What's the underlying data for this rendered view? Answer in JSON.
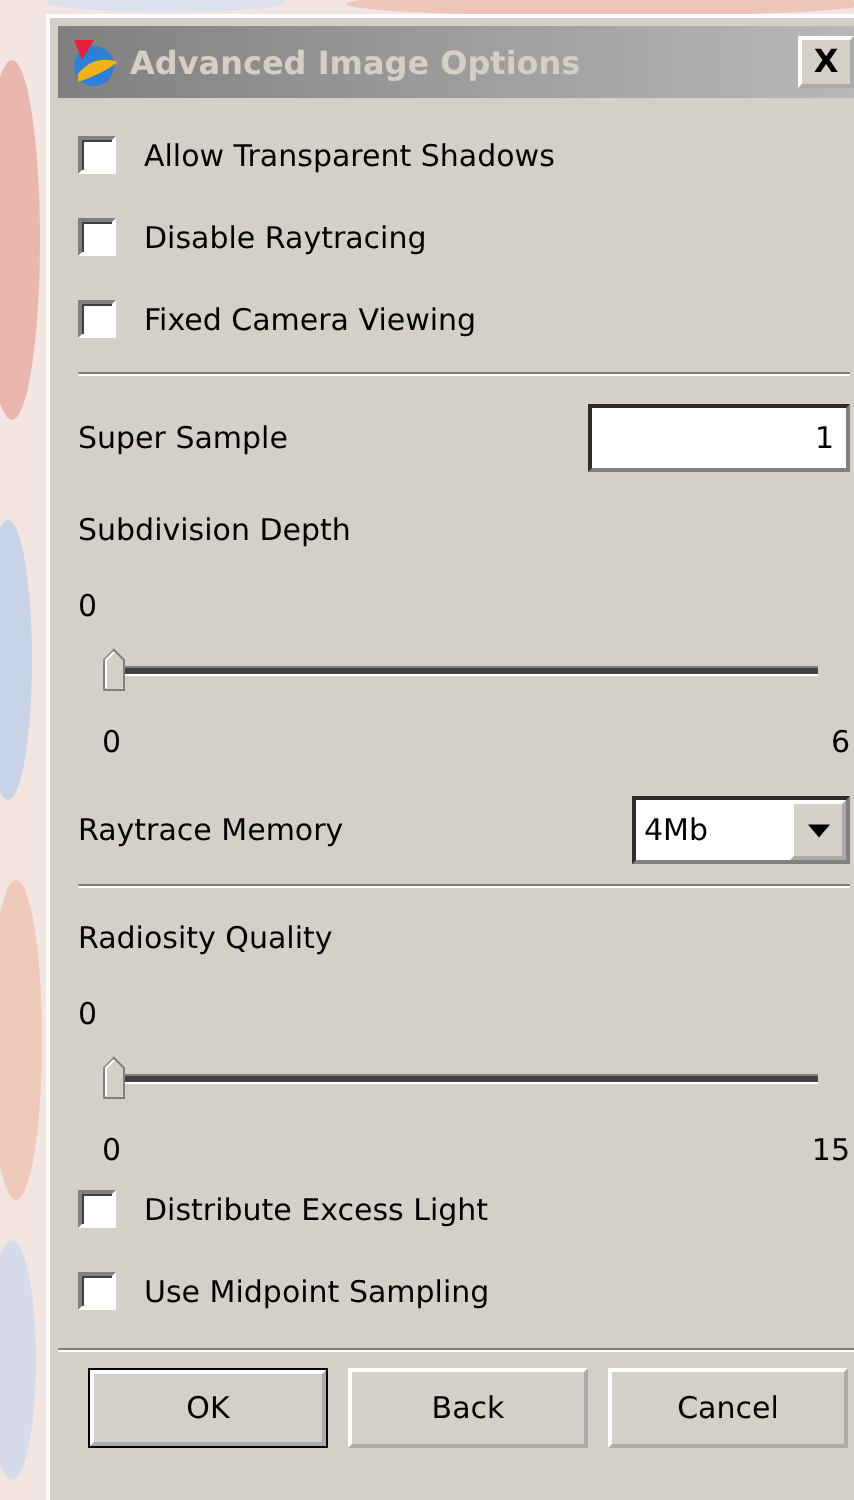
{
  "window": {
    "title": "Advanced Image Options",
    "close": "X"
  },
  "top_options": [
    {
      "label": "Allow Transparent Shadows",
      "checked": false
    },
    {
      "label": "Disable Raytracing",
      "checked": false
    },
    {
      "label": "Fixed Camera Viewing",
      "checked": false
    }
  ],
  "super_sample": {
    "label": "Super Sample",
    "value": "1"
  },
  "subdivision_depth": {
    "label": "Subdivision Depth",
    "reading": "0",
    "level": 0,
    "min": "0",
    "max": "6"
  },
  "raytrace_memory": {
    "label": "Raytrace Memory",
    "value": "4Mb"
  },
  "radiosity_quality": {
    "label": "Radiosity Quality",
    "reading": "0",
    "level": 0,
    "min": "0",
    "max": "15"
  },
  "bottom_options": [
    {
      "label": "Distribute Excess Light",
      "checked": false
    },
    {
      "label": "Use Midpoint Sampling",
      "checked": false
    }
  ],
  "buttons": [
    {
      "label": "OK",
      "default": true
    },
    {
      "label": "Back",
      "default": false
    },
    {
      "label": "Cancel",
      "default": false
    }
  ]
}
